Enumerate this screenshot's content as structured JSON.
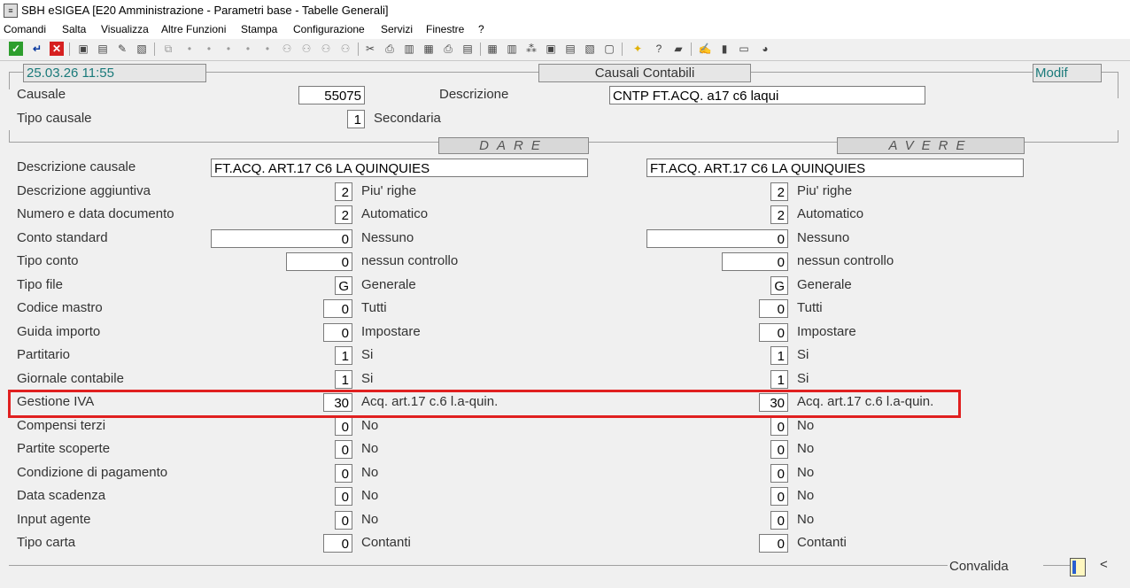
{
  "window": {
    "title": "SBH eSIGEA [E20 Amministrazione - Parametri base - Tabelle Generali]"
  },
  "menu": [
    "Comandi",
    "Salta",
    "Visualizza",
    "Altre Funzioni",
    "Stampa",
    "Configurazione",
    "Servizi",
    "Finestre",
    "?"
  ],
  "header": {
    "datetime": "25.03.26 11:55",
    "title": "Causali Contabili",
    "mode": "Modif"
  },
  "top": {
    "causale_label": "Causale",
    "causale_value": "55075",
    "descrizione_label": "Descrizione",
    "descrizione_value": "CNTP FT.ACQ. a17 c6 laqui",
    "tipo_label": "Tipo causale",
    "tipo_value": "1",
    "tipo_desc": "Secondaria"
  },
  "sections": {
    "dare": "DARE",
    "avere": "AVERE"
  },
  "rows": [
    {
      "label": "Descrizione causale"
    },
    {
      "label": "Descrizione aggiuntiva"
    },
    {
      "label": "Numero e data documento"
    },
    {
      "label": "Conto standard"
    },
    {
      "label": "Tipo conto"
    },
    {
      "label": "Tipo file"
    },
    {
      "label": "Codice mastro"
    },
    {
      "label": "Guida importo"
    },
    {
      "label": "Partitario"
    },
    {
      "label": "Giornale contabile"
    },
    {
      "label": "Gestione IVA"
    },
    {
      "label": "Compensi terzi"
    },
    {
      "label": "Partite scoperte"
    },
    {
      "label": "Condizione di pagamento"
    },
    {
      "label": "Data scadenza"
    },
    {
      "label": "Input agente"
    },
    {
      "label": "Tipo carta"
    }
  ],
  "dare": [
    {
      "value": "FT.ACQ. ART.17 C6 LA QUINQUIES",
      "desc": ""
    },
    {
      "value": "2",
      "desc": "Piu' righe"
    },
    {
      "value": "2",
      "desc": "Automatico"
    },
    {
      "value": "0",
      "desc": "Nessuno"
    },
    {
      "value": "0",
      "desc": "nessun controllo"
    },
    {
      "value": "G",
      "desc": "Generale"
    },
    {
      "value": "0",
      "desc": "Tutti"
    },
    {
      "value": "0",
      "desc": "Impostare"
    },
    {
      "value": "1",
      "desc": "Si"
    },
    {
      "value": "1",
      "desc": "Si"
    },
    {
      "value": "30",
      "desc": "Acq. art.17 c.6 l.a-quin."
    },
    {
      "value": "0",
      "desc": "No"
    },
    {
      "value": "0",
      "desc": "No"
    },
    {
      "value": "0",
      "desc": "No"
    },
    {
      "value": "0",
      "desc": "No"
    },
    {
      "value": "0",
      "desc": "No"
    },
    {
      "value": "0",
      "desc": "Contanti"
    }
  ],
  "avere": [
    {
      "value": "FT.ACQ. ART.17 C6 LA QUINQUIES",
      "desc": ""
    },
    {
      "value": "2",
      "desc": "Piu' righe"
    },
    {
      "value": "2",
      "desc": "Automatico"
    },
    {
      "value": "0",
      "desc": "Nessuno"
    },
    {
      "value": "0",
      "desc": "nessun controllo"
    },
    {
      "value": "G",
      "desc": "Generale"
    },
    {
      "value": "0",
      "desc": "Tutti"
    },
    {
      "value": "0",
      "desc": "Impostare"
    },
    {
      "value": "1",
      "desc": "Si"
    },
    {
      "value": "1",
      "desc": "Si"
    },
    {
      "value": "30",
      "desc": "Acq. art.17 c.6 l.a-quin."
    },
    {
      "value": "0",
      "desc": "No"
    },
    {
      "value": "0",
      "desc": "No"
    },
    {
      "value": "0",
      "desc": "No"
    },
    {
      "value": "0",
      "desc": "No"
    },
    {
      "value": "0",
      "desc": "No"
    },
    {
      "value": "0",
      "desc": "Contanti"
    }
  ],
  "footer": {
    "convalida": "Convalida",
    "arrow": "<"
  },
  "colors": {
    "accent_teal": "#1a7a7a",
    "highlight_red": "#e02020"
  }
}
